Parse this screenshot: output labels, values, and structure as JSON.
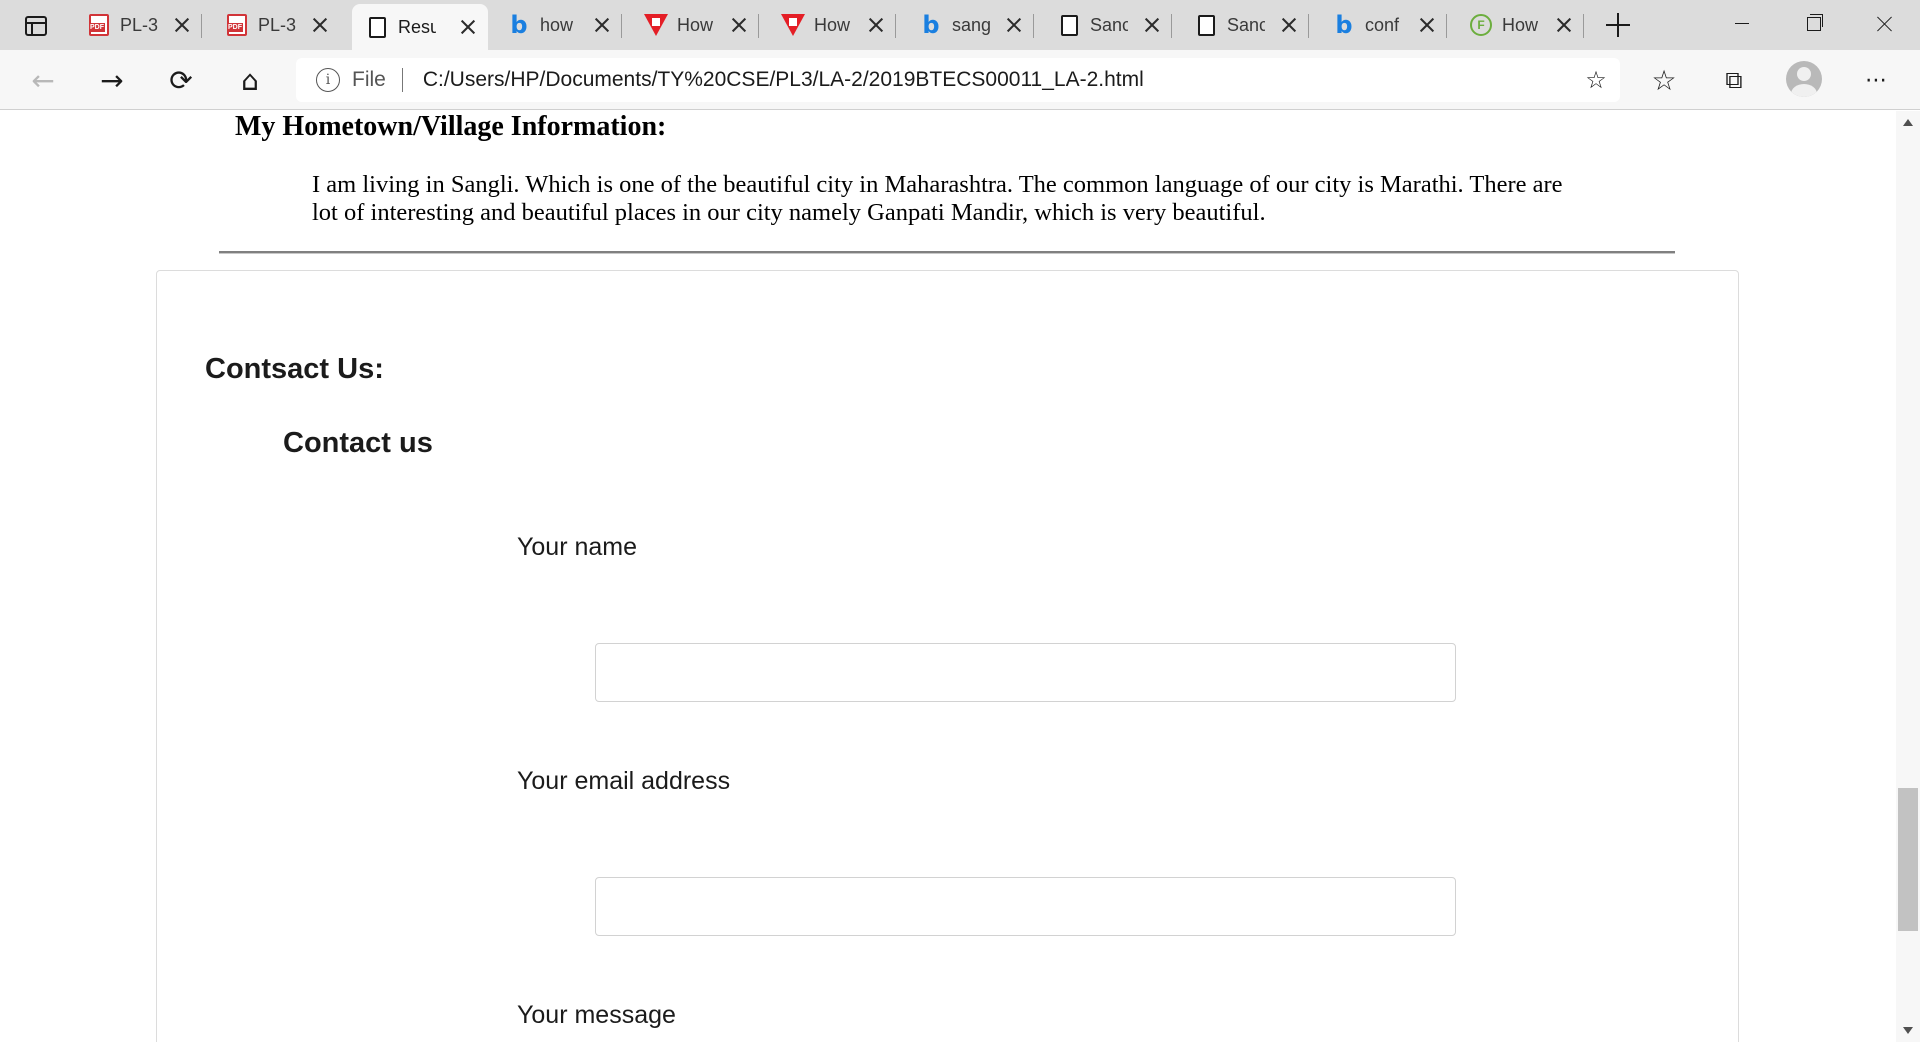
{
  "browser": {
    "tabs": [
      {
        "label": "PL-3",
        "icon": "pdf-icon",
        "active": false
      },
      {
        "label": "PL-3",
        "icon": "pdf-icon",
        "active": false
      },
      {
        "label": "Resu",
        "icon": "page-icon",
        "active": true
      },
      {
        "label": "how",
        "icon": "bing-icon",
        "active": false
      },
      {
        "label": "How",
        "icon": "triangle-logo-icon",
        "active": false
      },
      {
        "label": "How",
        "icon": "triangle-logo-icon",
        "active": false
      },
      {
        "label": "sang",
        "icon": "bing-icon",
        "active": false
      },
      {
        "label": "Sanc",
        "icon": "page-icon",
        "active": false
      },
      {
        "label": "Sanc",
        "icon": "page-icon",
        "active": false
      },
      {
        "label": "conf",
        "icon": "bing-icon",
        "active": false
      },
      {
        "label": "How",
        "icon": "f-logo-icon",
        "active": false
      }
    ],
    "address": {
      "scheme": "File",
      "url": "C:/Users/HP/Documents/TY%20CSE/PL3/LA-2/2019BTECS00011_LA-2.html"
    }
  },
  "page": {
    "hometown_heading": "My Hometown/Village Information:",
    "hometown_text": "I am living in Sangli. Which is one of the beautiful city in Maharashtra. The common language of our city is Marathi. There are lot of interesting and beautiful places in our city namely Ganpati Mandir, which is very beautiful.",
    "contact": {
      "title": "Contsact Us:",
      "subtitle": "Contact us",
      "name_label": "Your name",
      "name_value": "",
      "email_label": "Your email address",
      "email_value": "",
      "message_label": "Your message"
    }
  }
}
